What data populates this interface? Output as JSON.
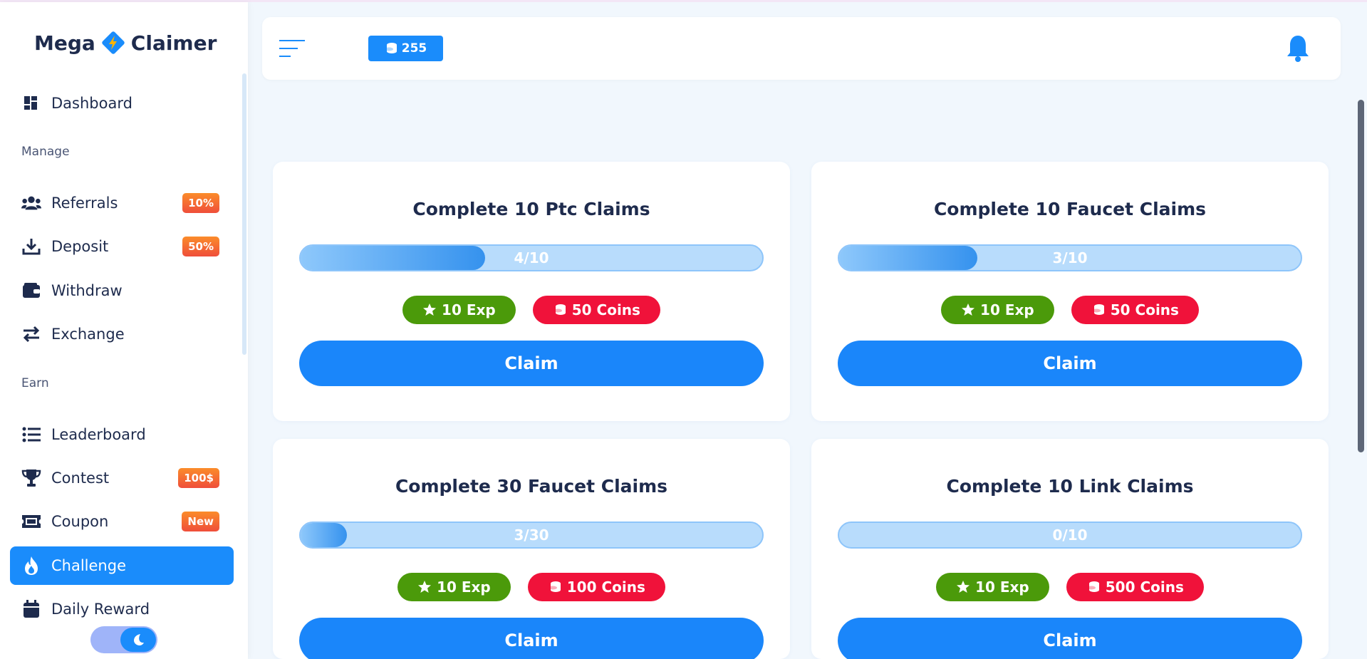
{
  "brand": {
    "name_left": "Mega",
    "name_right": "Claimer"
  },
  "header": {
    "coin_balance": "255"
  },
  "nav": {
    "dashboard": "Dashboard",
    "manage_label": "Manage",
    "referrals": "Referrals",
    "referrals_badge": "10%",
    "deposit": "Deposit",
    "deposit_badge": "50%",
    "withdraw": "Withdraw",
    "exchange": "Exchange",
    "earn_label": "Earn",
    "leaderboard": "Leaderboard",
    "contest": "Contest",
    "contest_badge": "100$",
    "coupon": "Coupon",
    "coupon_badge": "New",
    "challenge": "Challenge",
    "daily_reward": "Daily Reward"
  },
  "challenges": [
    {
      "title": "Complete 10 Ptc Claims",
      "current": 4,
      "total": 10,
      "progress_text": "4/10",
      "exp": "10 Exp",
      "coins": "50 Coins",
      "claim": "Claim"
    },
    {
      "title": "Complete 10 Faucet Claims",
      "current": 3,
      "total": 10,
      "progress_text": "3/10",
      "exp": "10 Exp",
      "coins": "50 Coins",
      "claim": "Claim"
    },
    {
      "title": "Complete 30 Faucet Claims",
      "current": 3,
      "total": 30,
      "progress_text": "3/30",
      "exp": "10 Exp",
      "coins": "100 Coins",
      "claim": "Claim"
    },
    {
      "title": "Complete 10 Link Claims",
      "current": 0,
      "total": 10,
      "progress_text": "0/10",
      "exp": "10 Exp",
      "coins": "500 Coins",
      "claim": "Claim"
    }
  ],
  "colors": {
    "accent": "#1a8cfb",
    "exp": "#4b9a0a",
    "coins": "#f0123a",
    "badge": "#ef4e3a"
  },
  "icons": {
    "star": "star-icon",
    "coins": "coins-icon",
    "bell": "bell-icon",
    "menu": "menu-icon",
    "moon": "moon-icon"
  }
}
